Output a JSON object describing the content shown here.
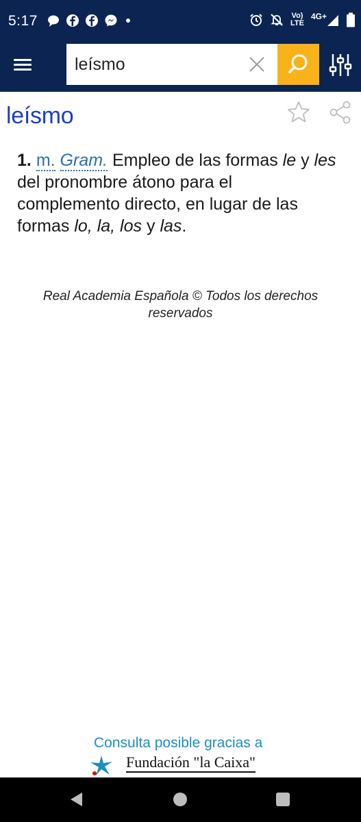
{
  "status_bar": {
    "time": "5:17",
    "network_label_top": "Vo)",
    "network_label_bottom": "LTE",
    "network_type": "4G+"
  },
  "search": {
    "value": "leísmo",
    "placeholder": ""
  },
  "entry": {
    "title": "leísmo",
    "senses": [
      {
        "number": "1.",
        "abbr1": "m.",
        "abbr2": "Gram.",
        "text1": " Empleo de las formas ",
        "it1": "le",
        "text2": " y ",
        "it2": "les",
        "text3": " del pronombre átono para el complemento directo, en lugar de las formas ",
        "it3": "lo, la, los",
        "text4": " y ",
        "it4": "las",
        "text5": "."
      }
    ]
  },
  "copyright": "Real Academia Española © Todos los derechos reservados",
  "sponsor": {
    "line1": "Consulta posible gracias a",
    "line2": "Fundación \"la Caixa\""
  },
  "colors": {
    "app_bar": "#0b2452",
    "search_button": "#f9b21a",
    "title": "#1a3fc9",
    "abbr_link": "#2a6fb6",
    "sponsor": "#1c8fc4"
  },
  "icons": [
    "message-icon",
    "facebook-icon",
    "messenger-icon",
    "alarm-icon",
    "mute-icon",
    "signal-icon",
    "battery-icon",
    "menu-icon",
    "close-icon",
    "search-icon",
    "filter-sliders-icon",
    "star-icon",
    "share-icon",
    "caixa-star-icon",
    "back-icon",
    "home-icon",
    "recents-icon"
  ]
}
